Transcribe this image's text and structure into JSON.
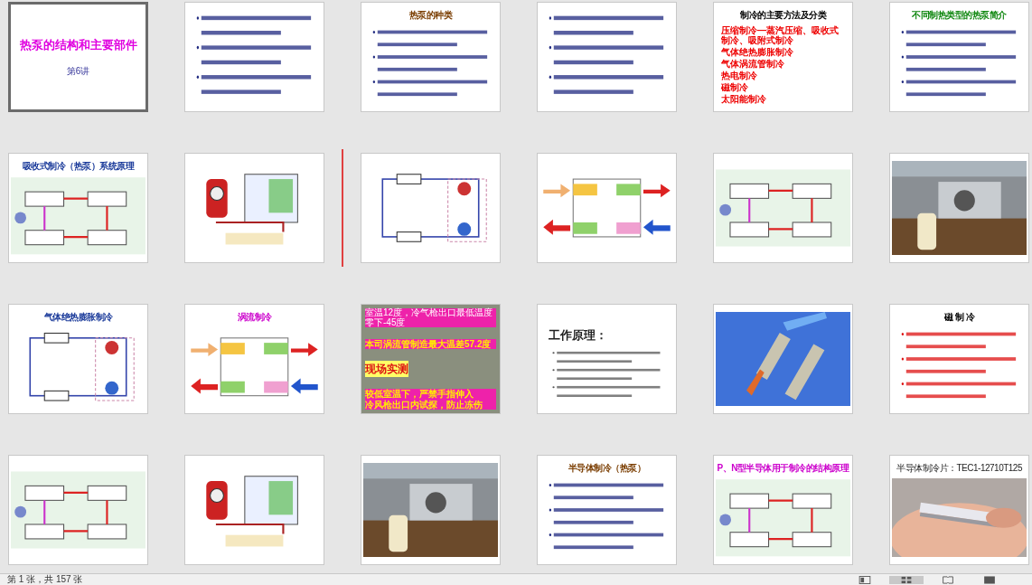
{
  "slides": [
    {
      "kind": "title",
      "title": "热泵的结构和主要部件",
      "color": "#e000e0",
      "subtitle": "第6讲",
      "selected": true
    },
    {
      "kind": "bullets",
      "selected": false
    },
    {
      "kind": "bullets",
      "title": "热泵的种类",
      "color": "#7a3d00",
      "selected": false
    },
    {
      "kind": "bullets",
      "selected": false
    },
    {
      "kind": "list",
      "title": "制冷的主要方法及分类",
      "color": "#000000",
      "items": [
        "压缩制冷—蒸汽压缩、吸收式制冷、吸附式制冷",
        "气体绝热膨胀制冷",
        "气体涡流管制冷",
        "热电制冷",
        "磁制冷",
        "太阳能制冷"
      ],
      "selected": false
    },
    {
      "kind": "bullets",
      "title": "不同制热类型的热泵简介",
      "color": "#118811",
      "selected": false
    },
    {
      "kind": "diagram",
      "title": "吸收式制冷（热泵）系统原理",
      "color": "#1a3a9a",
      "selected": false
    },
    {
      "kind": "diagram",
      "selected": false
    },
    {
      "kind": "diagram",
      "selected": false,
      "insert_before": true
    },
    {
      "kind": "diagram",
      "selected": false
    },
    {
      "kind": "diagram",
      "selected": false
    },
    {
      "kind": "picture",
      "selected": false
    },
    {
      "kind": "diagram",
      "title": "气体绝热膨胀制冷",
      "color": "#1a3a9a",
      "selected": false
    },
    {
      "kind": "diagram",
      "title": "涡流制冷",
      "color": "#cc00cc",
      "selected": false
    },
    {
      "kind": "overlay",
      "lines": [
        "室温12度，冷气枪出口最低温度零下-45度",
        "本司涡流管制造最大温差57.2度",
        "现场实测",
        "较低室温下，严禁手指伸入",
        "冷风枪出口内试探，防止冻伤"
      ],
      "selected": false
    },
    {
      "kind": "heading",
      "title": "工作原理：",
      "color": "#222222",
      "selected": false
    },
    {
      "kind": "picture",
      "selected": false
    },
    {
      "kind": "alert",
      "title": "磁 制 冷",
      "color": "#000000",
      "selected": false
    },
    {
      "kind": "diagram",
      "selected": false
    },
    {
      "kind": "diagram",
      "selected": false
    },
    {
      "kind": "picture",
      "selected": false
    },
    {
      "kind": "bullets",
      "title": "半导体制冷（热泵）",
      "color": "#7a3d00",
      "selected": false
    },
    {
      "kind": "diagram",
      "title": "P、N型半导体用于制冷的结构原理",
      "color": "#cc00cc",
      "selected": false
    },
    {
      "kind": "picture",
      "title": "半导体制冷片：TEC1-12710T125",
      "color": "#222222",
      "selected": false
    }
  ],
  "status_bar": {
    "text": "第 1 张，共 157 张",
    "views": [
      {
        "selected": false
      },
      {
        "selected": true
      },
      {
        "selected": false
      },
      {
        "selected": false
      }
    ]
  }
}
